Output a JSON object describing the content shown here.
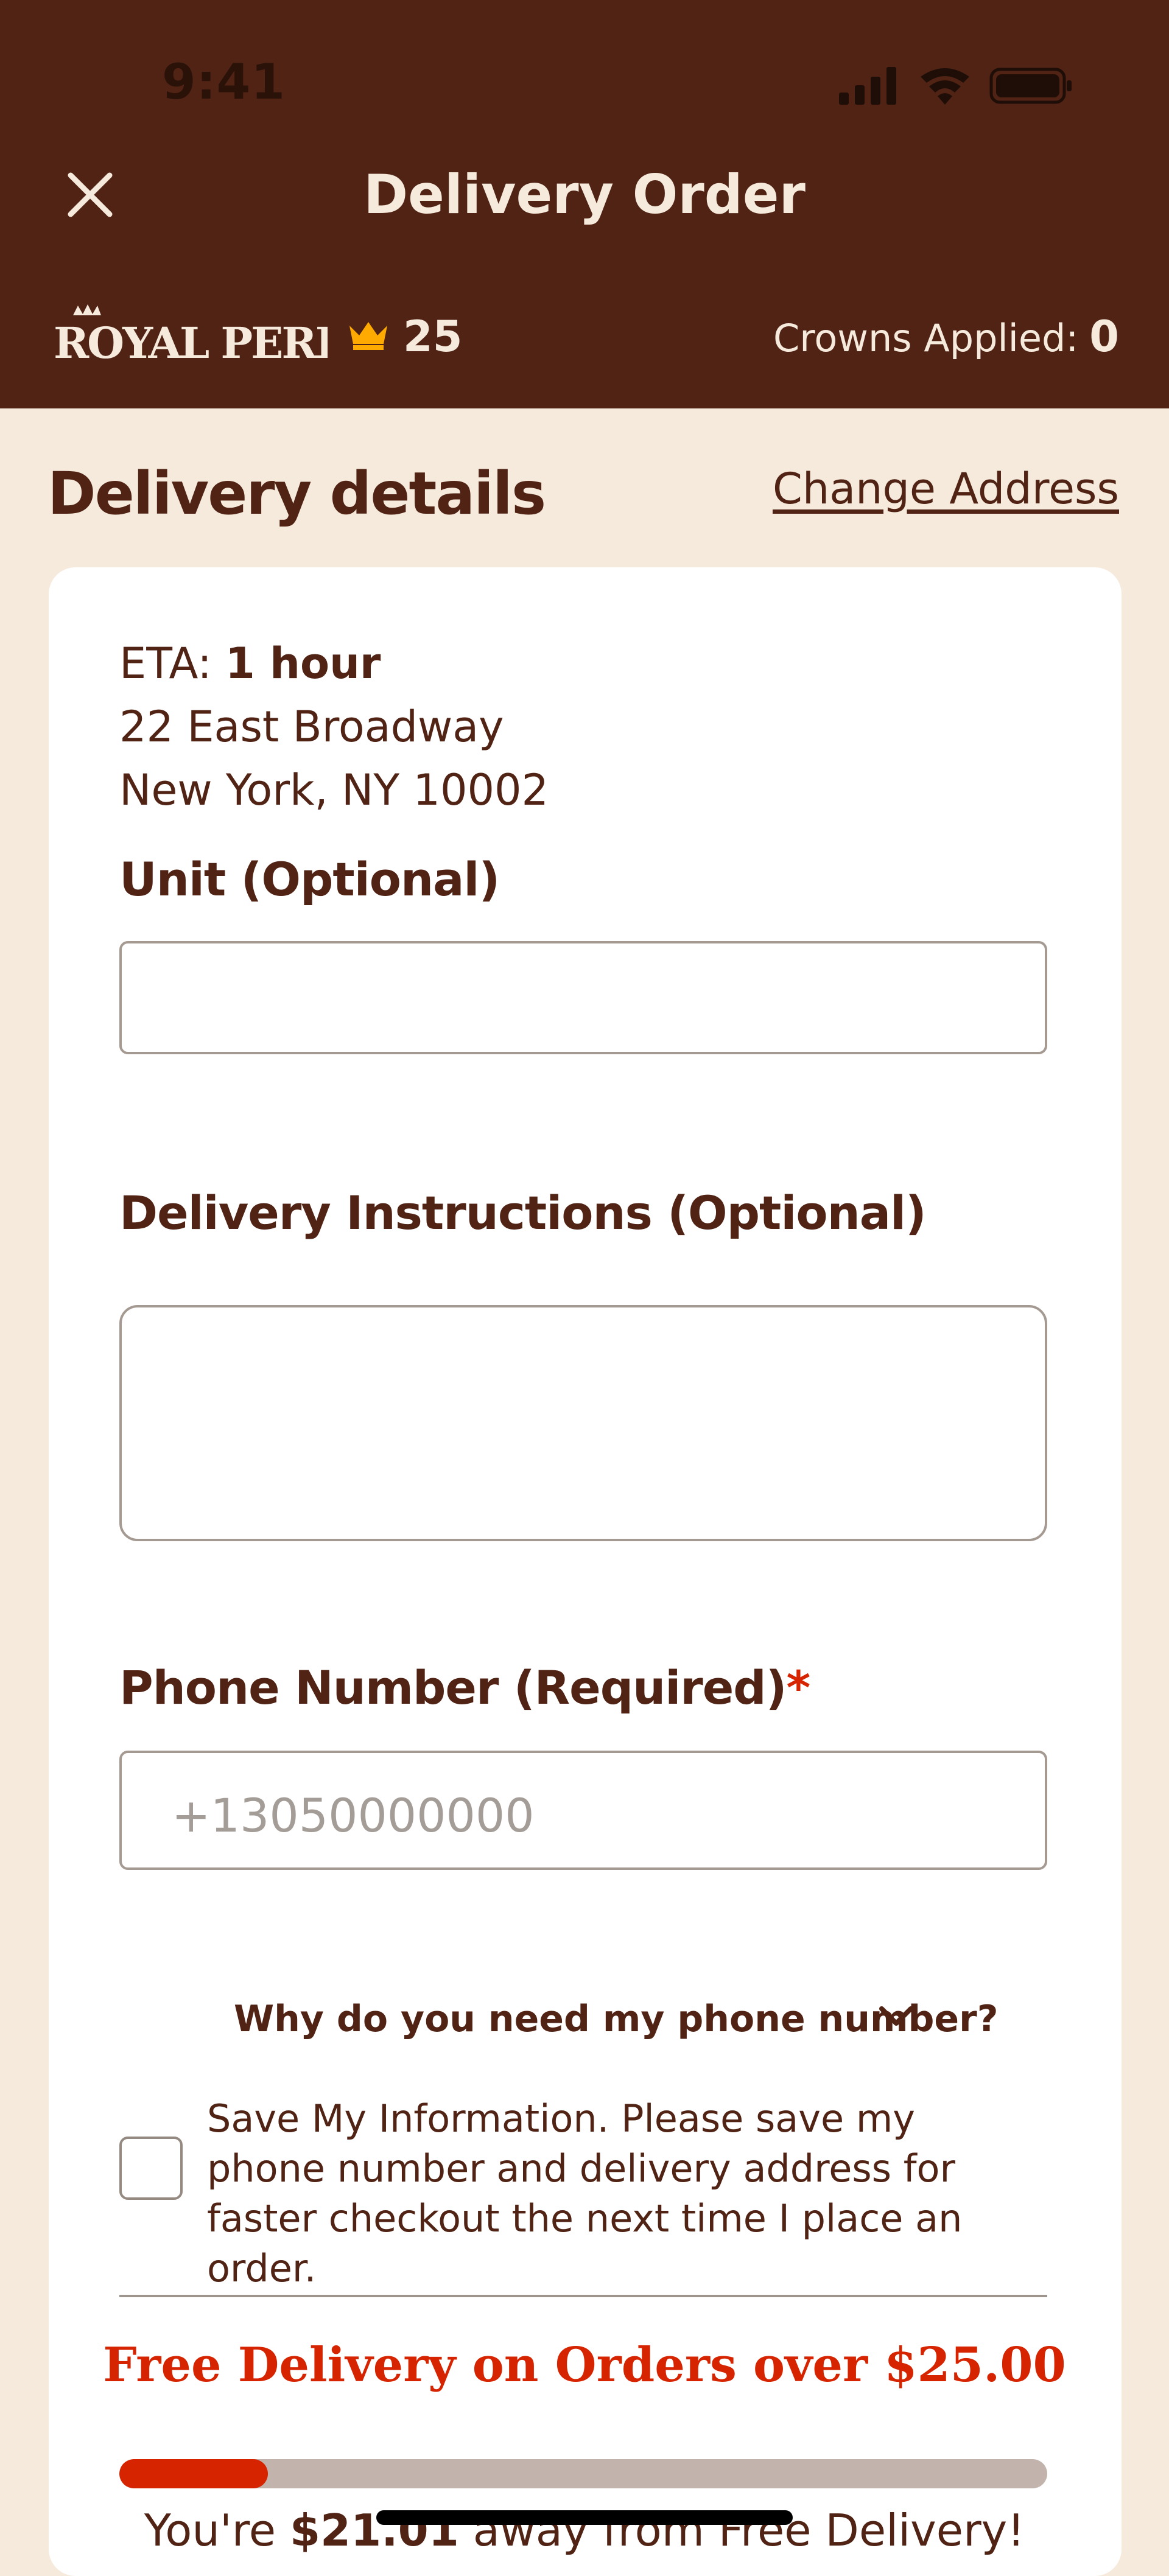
{
  "status_bar": {
    "time": "9:41"
  },
  "header": {
    "title": "Delivery Order",
    "brand": "ROYAL PERKS",
    "points": "25",
    "crowns_applied_label": "Crowns Applied:",
    "crowns_applied_value": "0"
  },
  "section": {
    "title": "Delivery details",
    "change_address": "Change Address"
  },
  "details": {
    "eta_label": "ETA:",
    "eta_value": "1 hour",
    "address_line1": "22 East Broadway",
    "address_line2": "New York, NY 10002"
  },
  "form": {
    "unit_label": "Unit (Optional)",
    "unit_value": "",
    "instructions_label": "Delivery Instructions (Optional)",
    "instructions_value": "",
    "phone_label": "Phone Number (Required)",
    "phone_required_mark": "*",
    "phone_placeholder": "+13050000000",
    "why_phone": "Why do you need my phone number?",
    "save_info_text": "Save My Information. Please save my phone number and delivery address for faster checkout the next time I place an order.",
    "save_info_checked": false
  },
  "delivery_promo": {
    "headline": "Free Delivery on Orders over $25.00",
    "progress_percent": 16,
    "away_prefix": "You're",
    "away_amount": "$21.01",
    "away_suffix": "away from Free Delivery!"
  },
  "colors": {
    "header_bg": "#502314",
    "page_bg": "#F5EADC",
    "accent_red": "#D62300",
    "crown_gold": "#FFAA00",
    "text_brown": "#502314"
  },
  "icons": [
    "close-icon",
    "crown-icon",
    "chevron-down-icon",
    "signal-icon",
    "wifi-icon",
    "battery-icon"
  ]
}
